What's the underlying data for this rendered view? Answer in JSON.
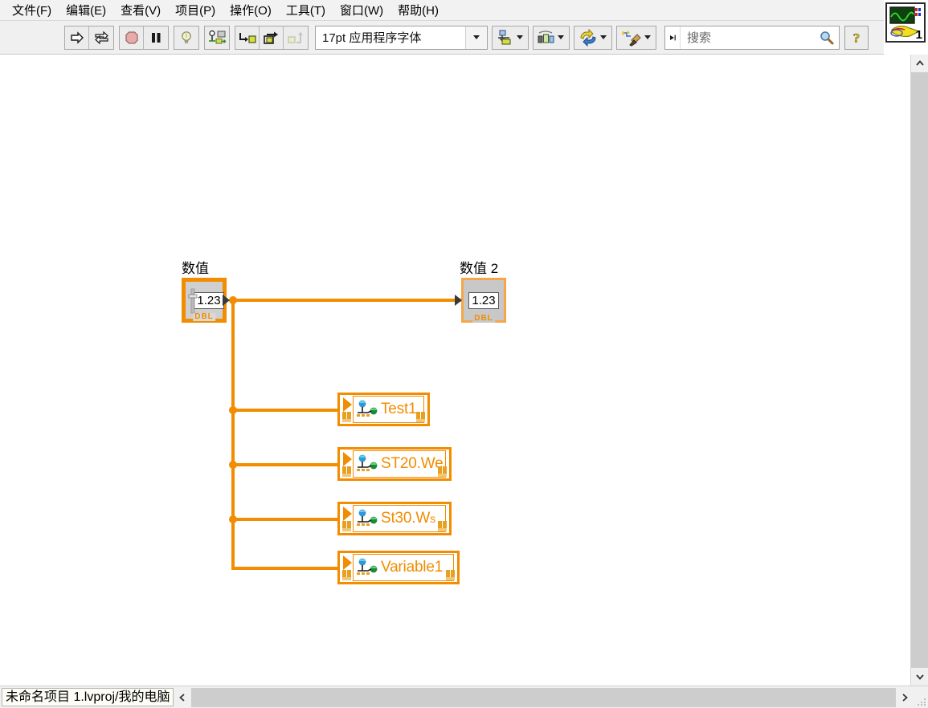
{
  "menubar": {
    "items": [
      {
        "label": "文件(F)",
        "name": "menu-file"
      },
      {
        "label": "编辑(E)",
        "name": "menu-edit"
      },
      {
        "label": "查看(V)",
        "name": "menu-view"
      },
      {
        "label": "项目(P)",
        "name": "menu-project"
      },
      {
        "label": "操作(O)",
        "name": "menu-operate"
      },
      {
        "label": "工具(T)",
        "name": "menu-tools"
      },
      {
        "label": "窗口(W)",
        "name": "menu-window"
      },
      {
        "label": "帮助(H)",
        "name": "menu-help"
      }
    ]
  },
  "toolbar": {
    "run_icon": "run-arrow-icon",
    "run_continuous_icon": "run-continuously-icon",
    "abort_icon": "abort-execution-icon",
    "pause_icon": "pause-icon",
    "highlight_icon": "highlight-execution-lightbulb-icon",
    "retain_values_icon": "retain-wire-values-icon",
    "step_into_icon": "step-into-icon",
    "step_over_icon": "step-over-icon",
    "step_out_icon": "step-out-icon",
    "font_selector_value": "17pt 应用程序字体",
    "align_icon": "align-objects-icon",
    "distribute_icon": "distribute-objects-icon",
    "reorder_icon": "reorder-objects-icon",
    "cleanup_icon": "clean-up-diagram-icon",
    "search_placeholder": "搜索",
    "search_value": "",
    "search_icon": "magnifier-icon",
    "help_icon": "help-question-icon",
    "vi_icon": "vi-connector-pane-icon",
    "vi_icon_number": "1"
  },
  "diagram": {
    "numeric_control": {
      "label": "数值",
      "value": "1.23",
      "datatype": "DBL",
      "icon": "numeric-control-terminal-icon"
    },
    "numeric_indicator": {
      "label": "数值 2",
      "value": "1.23",
      "datatype": "DBL",
      "icon": "numeric-indicator-terminal-icon"
    },
    "shared_variables": [
      {
        "name": "Test1",
        "icon": "shared-variable-icon"
      },
      {
        "name": "ST20.We",
        "icon": "shared-variable-icon"
      },
      {
        "name": "St30.W",
        "suffix": "s",
        "icon": "shared-variable-icon"
      },
      {
        "name": "Variable1",
        "icon": "shared-variable-icon"
      }
    ],
    "wire_color": "#F28C00"
  },
  "statusbar": {
    "path": "未命名项目 1.lvproj/我的电脑",
    "scroll_left_icon": "scroll-left-icon",
    "scroll_right_icon": "scroll-right-icon",
    "resize_grip_icon": "resize-grip-icon"
  },
  "scrollbar": {
    "up_icon": "scroll-up-icon",
    "down_icon": "scroll-down-icon"
  }
}
